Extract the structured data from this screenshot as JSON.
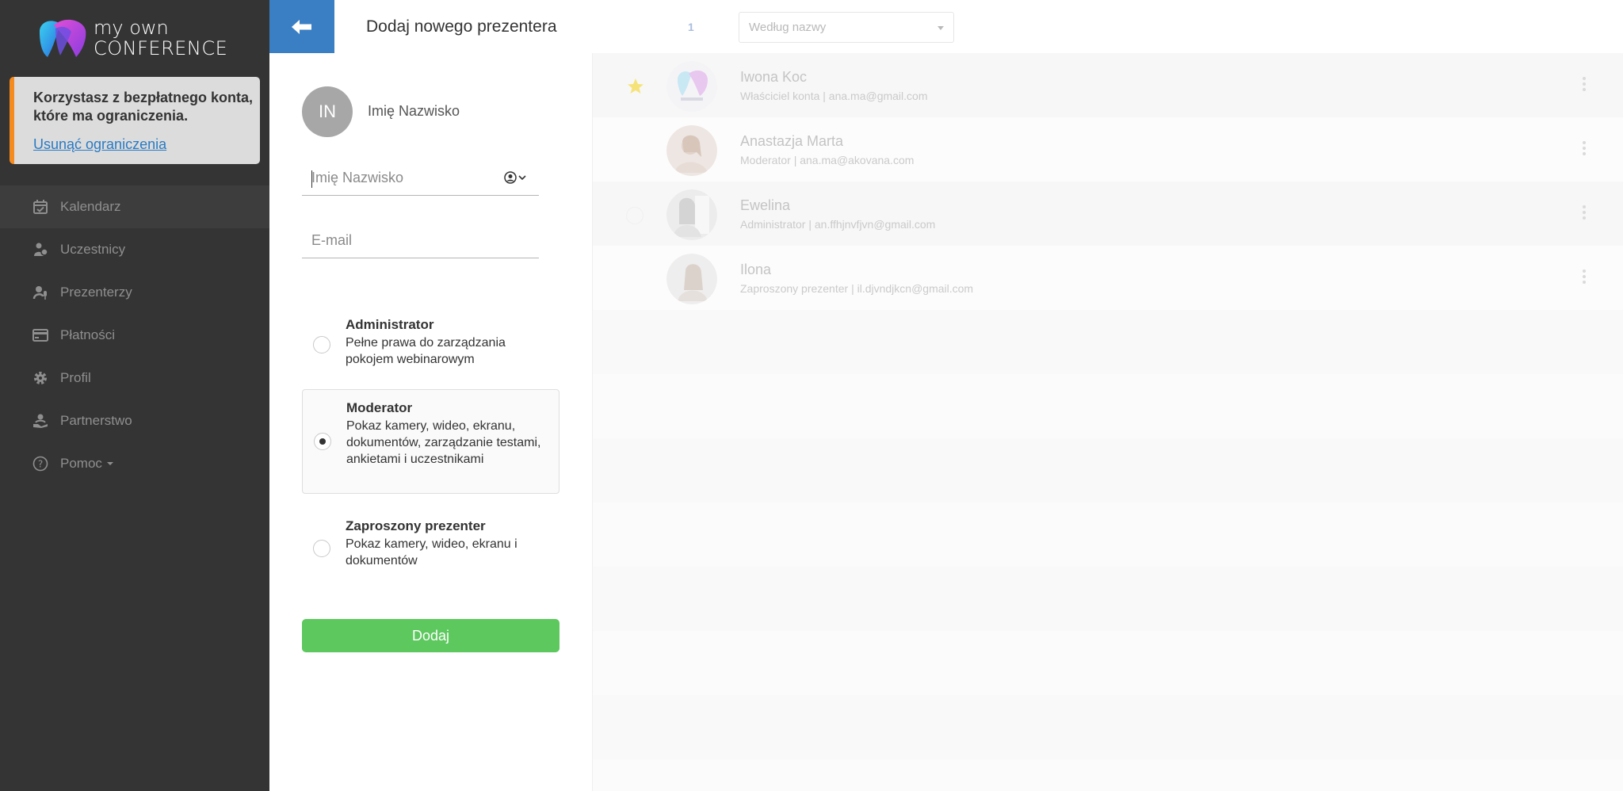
{
  "brand": {
    "line1": "my own",
    "line2": "CONFERENCE"
  },
  "notice": {
    "text": "Korzystasz z bezpłatnego konta, które ma ograniczenia.",
    "link": "Usunąć ograniczenia",
    "accent": "#f58a1f"
  },
  "menu": {
    "items": [
      {
        "label": "Kalendarz",
        "icon": "calendar-icon"
      },
      {
        "label": "Uczestnicy",
        "icon": "participants-icon"
      },
      {
        "label": "Prezenterzy",
        "icon": "microphone-icon"
      },
      {
        "label": "Płatności",
        "icon": "credit-card-icon"
      },
      {
        "label": "Profil",
        "icon": "gear-icon"
      },
      {
        "label": "Partnerstwo",
        "icon": "partnership-icon"
      },
      {
        "label": "Pomoc",
        "icon": "help-icon"
      }
    ]
  },
  "header": {
    "title": "Dodaj nowego prezentera",
    "count": "1",
    "sort": {
      "value": "Według nazwy"
    },
    "accent": "#3a7fc4"
  },
  "form": {
    "preview": {
      "initials": "IN",
      "name": "Imię Nazwisko"
    },
    "name_placeholder": "Imię Nazwisko",
    "email_placeholder": "E-mail",
    "roles": [
      {
        "title": "Administrator",
        "desc": "Pełne prawa do zarządzania pokojem webinarowym",
        "selected": false
      },
      {
        "title": "Moderator",
        "desc": "Pokaz kamery, wideo, ekranu, dokumentów, zarządzanie testami, ankietami i uczestnikami",
        "selected": true
      },
      {
        "title": "Zaproszony prezenter",
        "desc": "Pokaz kamery, wideo, ekranu i dokumentów",
        "selected": false
      }
    ],
    "submit": "Dodaj",
    "submit_color": "#5cc85e"
  },
  "presenters": [
    {
      "name": "Iwona Koc",
      "sub": "Właściciel konta | ana.ma@gmail.com",
      "starred": true
    },
    {
      "name": "Anastazja Marta",
      "sub": "Moderator | ana.ma@akovana.com",
      "starred": false
    },
    {
      "name": "Ewelina",
      "sub": "Administrator | an.ffhjnvfjvn@gmail.com",
      "starred": false
    },
    {
      "name": "Ilona",
      "sub": "Zaproszony prezenter | il.djvndjkcn@gmail.com",
      "starred": false
    }
  ]
}
